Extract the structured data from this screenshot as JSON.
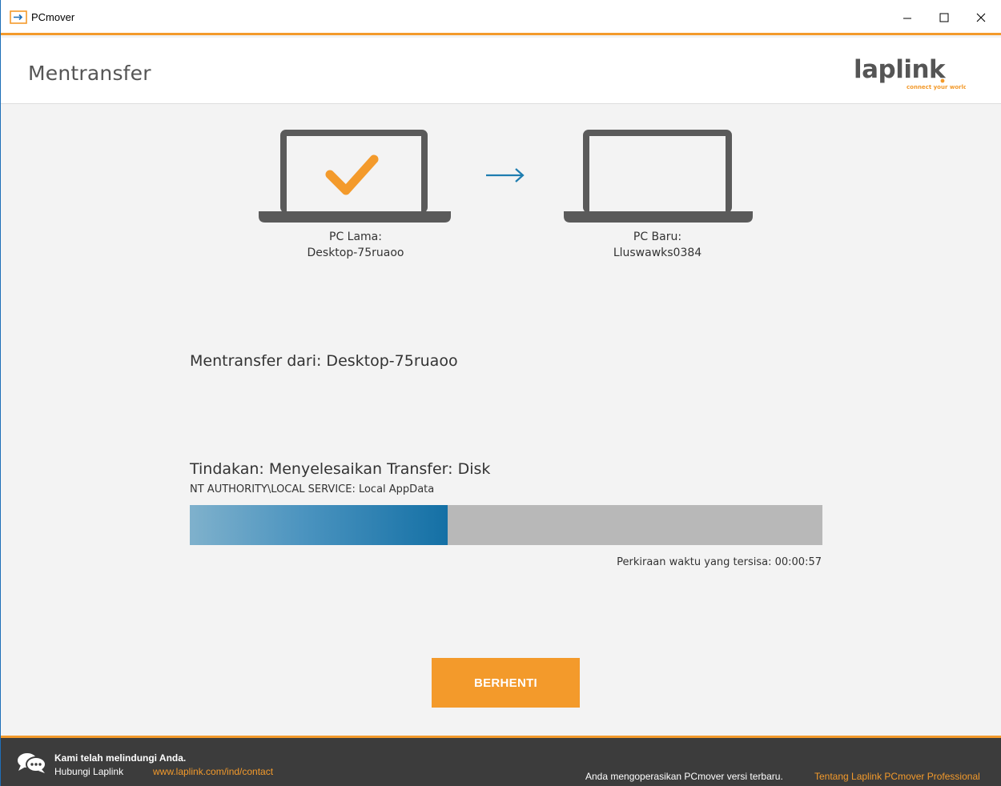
{
  "window": {
    "title": "PCmover",
    "minimize": "–",
    "maximize": "☐",
    "close": "✕"
  },
  "header": {
    "page_title": "Mentransfer",
    "logo_text": "laplink",
    "logo_tagline": "connect your world"
  },
  "computers": {
    "old": {
      "label": "PC Lama:",
      "name": "Desktop-75ruaoo"
    },
    "new": {
      "label": "PC Baru:",
      "name": "Lluswawks0384"
    }
  },
  "transfer": {
    "from_text": "Mentransfer dari: Desktop-75ruaoo",
    "action_text": "Tindakan: Menyelesaikan Transfer: Disk",
    "action_detail": "NT AUTHORITY\\LOCAL SERVICE: Local AppData",
    "progress_fraction": 0.407,
    "time_remaining": "Perkiraan waktu yang tersisa: 00:00:57"
  },
  "actions": {
    "stop_label": "BERHENTI"
  },
  "footer": {
    "protect_text": "Kami telah melindungi Anda.",
    "contact_label": "Hubungi Laplink",
    "contact_link": "www.laplink.com/ind/contact",
    "version_text": "Anda mengoperasikan PCmover versi terbaru.",
    "about_link": "Tentang Laplink PCmover Professional"
  },
  "colors": {
    "accent": "#f39a2b",
    "progress": "#1470a5",
    "footer_bg": "#3c3c3c"
  }
}
